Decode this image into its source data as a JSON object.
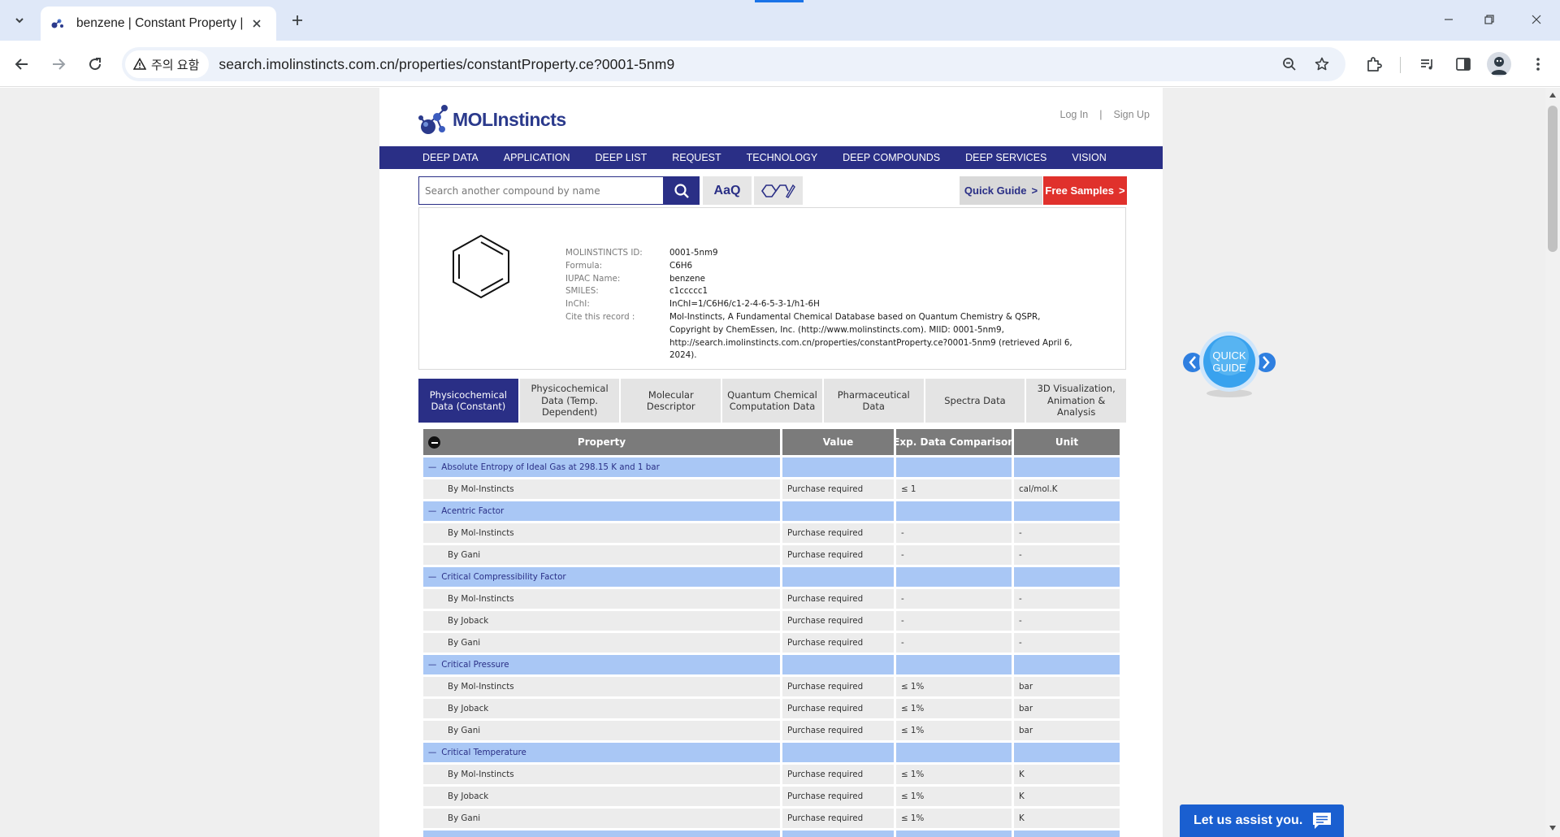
{
  "browser": {
    "tab_title": "benzene | Constant Property |",
    "security_label": "주의 요함",
    "url": "search.imolinstincts.com.cn/properties/constantProperty.ce?0001-5nm9"
  },
  "site": {
    "logo": "MOLInstincts",
    "login": "Log In",
    "auth_sep": "|",
    "signup": "Sign Up",
    "nav": [
      "DEEP DATA",
      "APPLICATION",
      "DEEP LIST",
      "REQUEST",
      "TECHNOLOGY",
      "DEEP COMPOUNDS",
      "DEEP SERVICES",
      "VISION"
    ],
    "search_placeholder": "Search another compound by name",
    "text_tool_label": "AaQ",
    "quick_guide": "Quick Guide",
    "free_samples": "Free Samples",
    "btn_arrow": ">",
    "widget_quick_guide": [
      "QUICK",
      "GUIDE"
    ],
    "chat_label": "Let us assist you."
  },
  "compound": {
    "rows": [
      {
        "label": "MOLINSTINCTS ID:",
        "value": "0001-5nm9"
      },
      {
        "label": "Formula:",
        "value": "C6H6"
      },
      {
        "label": "IUPAC Name:",
        "value": "benzene"
      },
      {
        "label": "SMILES:",
        "value": "c1ccccc1"
      },
      {
        "label": "InChI:",
        "value": "InChI=1/C6H6/c1-2-4-6-5-3-1/h1-6H"
      },
      {
        "label": "Cite this record :",
        "value": "Mol-Instincts, A Fundamental Chemical Database based on Quantum Chemistry & QSPR, Copyright by ChemEssen, Inc. (http://www.molinstincts.com). MIID: 0001-5nm9, http://search.imolinstincts.com.cn/properties/constantProperty.ce?0001-5nm9 (retrieved April 6, 2024)."
      }
    ]
  },
  "subtabs": [
    {
      "label": "Physicochemical Data (Constant)",
      "active": true
    },
    {
      "label": "Physicochemical Data (Temp. Dependent)",
      "active": false
    },
    {
      "label": "Molecular Descriptor",
      "active": false
    },
    {
      "label": "Quantum Chemical Computation Data",
      "active": false
    },
    {
      "label": "Pharmaceutical Data",
      "active": false
    },
    {
      "label": "Spectra Data",
      "active": false
    },
    {
      "label": "3D Visualization, Animation & Analysis",
      "active": false
    }
  ],
  "table": {
    "headers": [
      "Property",
      "Value",
      "Exp. Data Comparison",
      "Unit"
    ],
    "group_prefix": "—",
    "rows": [
      {
        "type": "group",
        "cells": [
          "Absolute Entropy of Ideal Gas at 298.15 K and 1 bar",
          "",
          "",
          ""
        ]
      },
      {
        "type": "sub",
        "cells": [
          "By Mol-Instincts",
          "Purchase required",
          "≤ 1",
          "cal/mol.K"
        ]
      },
      {
        "type": "group",
        "cells": [
          "Acentric Factor",
          "",
          "",
          ""
        ]
      },
      {
        "type": "sub",
        "cells": [
          "By Mol-Instincts",
          "Purchase required",
          "-",
          "-"
        ]
      },
      {
        "type": "sub",
        "cells": [
          "By Gani",
          "Purchase required",
          "-",
          "-"
        ]
      },
      {
        "type": "group",
        "cells": [
          "Critical Compressibility Factor",
          "",
          "",
          ""
        ]
      },
      {
        "type": "sub",
        "cells": [
          "By Mol-Instincts",
          "Purchase required",
          "-",
          "-"
        ]
      },
      {
        "type": "sub",
        "cells": [
          "By Joback",
          "Purchase required",
          "-",
          "-"
        ]
      },
      {
        "type": "sub",
        "cells": [
          "By Gani",
          "Purchase required",
          "-",
          "-"
        ]
      },
      {
        "type": "group",
        "cells": [
          "Critical Pressure",
          "",
          "",
          ""
        ]
      },
      {
        "type": "sub",
        "cells": [
          "By Mol-Instincts",
          "Purchase required",
          "≤ 1%",
          "bar"
        ]
      },
      {
        "type": "sub",
        "cells": [
          "By Joback",
          "Purchase required",
          "≤ 1%",
          "bar"
        ]
      },
      {
        "type": "sub",
        "cells": [
          "By Gani",
          "Purchase required",
          "≤ 1%",
          "bar"
        ]
      },
      {
        "type": "group",
        "cells": [
          "Critical Temperature",
          "",
          "",
          ""
        ]
      },
      {
        "type": "sub",
        "cells": [
          "By Mol-Instincts",
          "Purchase required",
          "≤ 1%",
          "K"
        ]
      },
      {
        "type": "sub",
        "cells": [
          "By Joback",
          "Purchase required",
          "≤ 1%",
          "K"
        ]
      },
      {
        "type": "sub",
        "cells": [
          "By Gani",
          "Purchase required",
          "≤ 1%",
          "K"
        ]
      },
      {
        "type": "group",
        "cells": [
          "",
          "",
          "",
          ""
        ]
      }
    ]
  },
  "colors": {
    "nav_bg": "#2a2f86",
    "free_samples_bg": "#e0312c",
    "group_row_bg": "#a9c7f5",
    "sub_row_bg": "#ececec",
    "header_bg": "#7b7b7b",
    "chat_bg": "#1a5fd0"
  }
}
